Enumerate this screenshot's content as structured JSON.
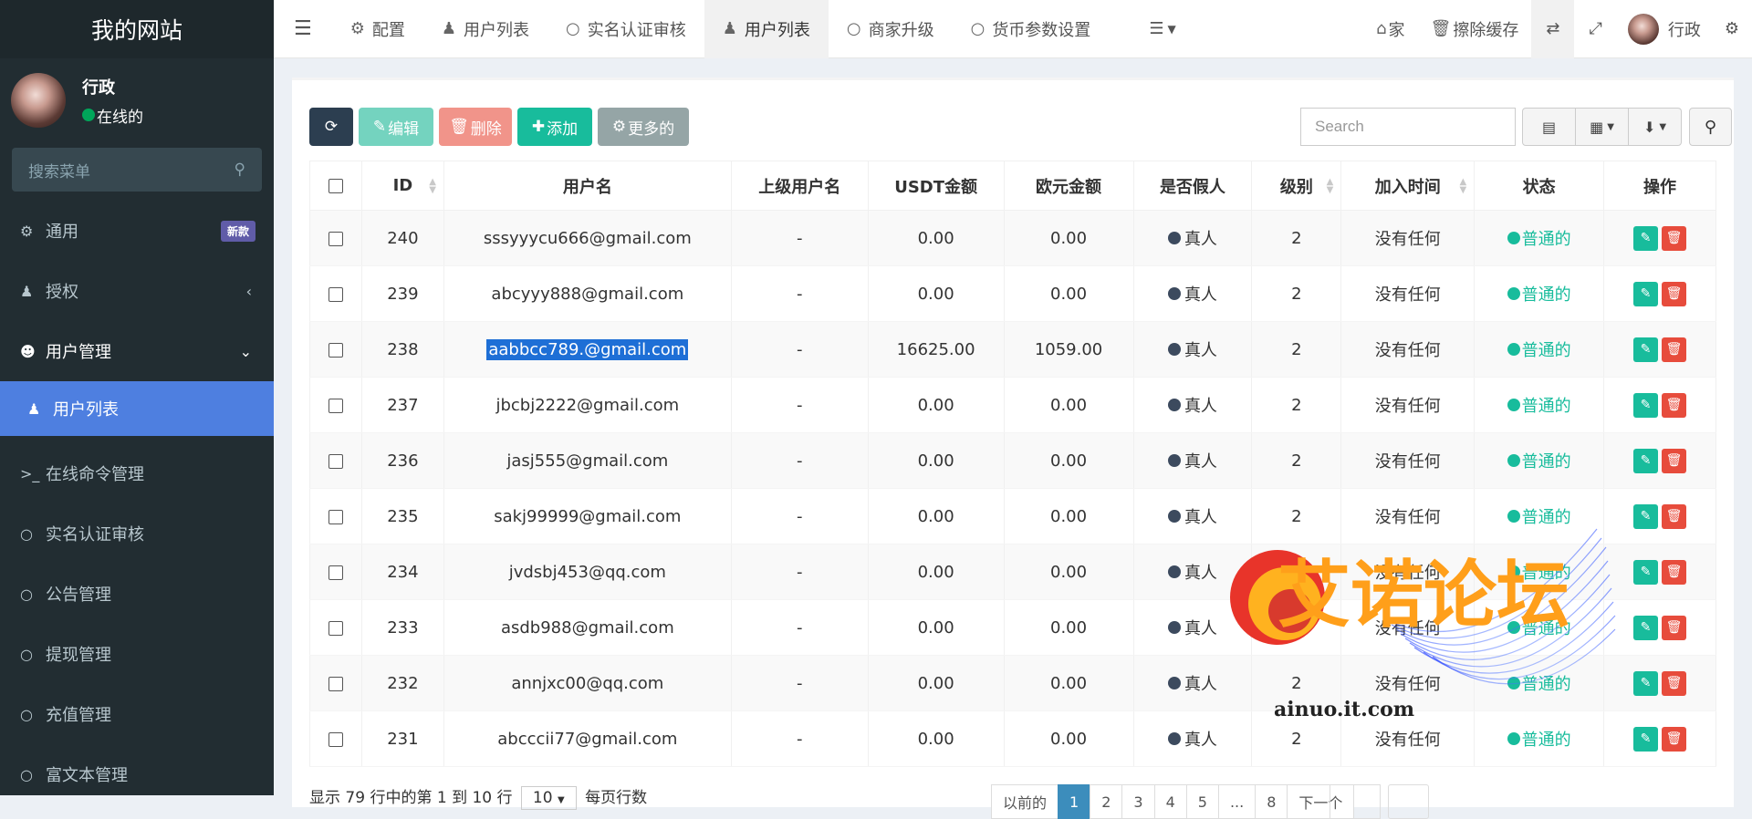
{
  "sidebar": {
    "site_title": "我的网站",
    "user_name": "行政",
    "user_status": "在线的",
    "search_placeholder": "搜索菜单",
    "menu": [
      {
        "label": "通用",
        "icon": "gears-icon",
        "badge": "新款"
      },
      {
        "label": "授权",
        "icon": "users-icon",
        "arrow": "‹"
      },
      {
        "label": "用户管理",
        "icon": "user-circle-icon",
        "arrow": "⌄"
      },
      {
        "label": "用户列表",
        "icon": "user-icon"
      },
      {
        "label": "在线命令管理",
        "icon": "terminal-icon"
      },
      {
        "label": "实名认证审核",
        "icon": "circle-icon"
      },
      {
        "label": "公告管理",
        "icon": "circle-icon"
      },
      {
        "label": "提现管理",
        "icon": "circle-icon"
      },
      {
        "label": "充值管理",
        "icon": "circle-icon"
      },
      {
        "label": "富文本管理",
        "icon": "circle-icon"
      }
    ]
  },
  "topbar": {
    "tabs": [
      {
        "label": "配置",
        "icon": "gear-icon"
      },
      {
        "label": "用户列表",
        "icon": "user-icon"
      },
      {
        "label": "实名认证审核",
        "icon": "circle-icon"
      },
      {
        "label": "用户列表",
        "icon": "user-icon",
        "active": true
      },
      {
        "label": "商家升级",
        "icon": "circle-icon"
      },
      {
        "label": "货币参数设置",
        "icon": "circle-icon"
      }
    ],
    "home_label": "家",
    "clear_cache_label": "擦除缓存",
    "user_name": "行政"
  },
  "toolbar": {
    "edit_label": "编辑",
    "delete_label": "删除",
    "add_label": "添加",
    "more_label": "更多的",
    "search_placeholder": "Search"
  },
  "table": {
    "columns": [
      "ID",
      "用户名",
      "上级用户名",
      "USDT金额",
      "欧元金额",
      "是否假人",
      "级别",
      "加入时间",
      "状态",
      "操作"
    ],
    "rows": [
      {
        "id": "240",
        "username": "sssyyycu666@gmail.com",
        "parent": "-",
        "usdt": "0.00",
        "eur": "0.00",
        "fake": "真人",
        "level": "2",
        "joined": "没有任何",
        "status": "普通的"
      },
      {
        "id": "239",
        "username": "abcyyy888@gmail.com",
        "parent": "-",
        "usdt": "0.00",
        "eur": "0.00",
        "fake": "真人",
        "level": "2",
        "joined": "没有任何",
        "status": "普通的"
      },
      {
        "id": "238",
        "username": "aabbcc789.@gmail.com",
        "parent": "-",
        "usdt": "16625.00",
        "eur": "1059.00",
        "fake": "真人",
        "level": "2",
        "joined": "没有任何",
        "status": "普通的"
      },
      {
        "id": "237",
        "username": "jbcbj2222@gmail.com",
        "parent": "-",
        "usdt": "0.00",
        "eur": "0.00",
        "fake": "真人",
        "level": "2",
        "joined": "没有任何",
        "status": "普通的"
      },
      {
        "id": "236",
        "username": "jasj555@gmail.com",
        "parent": "-",
        "usdt": "0.00",
        "eur": "0.00",
        "fake": "真人",
        "level": "2",
        "joined": "没有任何",
        "status": "普通的"
      },
      {
        "id": "235",
        "username": "sakj99999@gmail.com",
        "parent": "-",
        "usdt": "0.00",
        "eur": "0.00",
        "fake": "真人",
        "level": "2",
        "joined": "没有任何",
        "status": "普通的"
      },
      {
        "id": "234",
        "username": "jvdsbj453@qq.com",
        "parent": "-",
        "usdt": "0.00",
        "eur": "0.00",
        "fake": "真人",
        "level": "2",
        "joined": "没有任何",
        "status": "普通的"
      },
      {
        "id": "233",
        "username": "asdb988@gmail.com",
        "parent": "-",
        "usdt": "0.00",
        "eur": "0.00",
        "fake": "真人",
        "level": "2",
        "joined": "没有任何",
        "status": "普通的"
      },
      {
        "id": "232",
        "username": "annjxc00@qq.com",
        "parent": "-",
        "usdt": "0.00",
        "eur": "0.00",
        "fake": "真人",
        "level": "2",
        "joined": "没有任何",
        "status": "普通的"
      },
      {
        "id": "231",
        "username": "abcccii77@gmail.com",
        "parent": "-",
        "usdt": "0.00",
        "eur": "0.00",
        "fake": "真人",
        "level": "2",
        "joined": "没有任何",
        "status": "普通的"
      }
    ]
  },
  "footer": {
    "summary": "显示 79 行中的第 1 到 10 行",
    "per_page_value": "10",
    "per_page_suffix": "每页行数",
    "pages": [
      "以前的",
      "1",
      "2",
      "3",
      "4",
      "5",
      "...",
      "8",
      "下一个"
    ]
  },
  "watermark": {
    "text": "艾诺论坛",
    "url": "ainuo.it.com"
  },
  "colors": {
    "sidebar_bg": "#222d32",
    "active_menu": "#4e7fe0",
    "primary_btn": "#2c3e50",
    "edit_btn": "#18bc9c",
    "delete_btn": "#e74c3c",
    "more_btn": "#95a5a6",
    "status_green": "#18bc9c"
  }
}
